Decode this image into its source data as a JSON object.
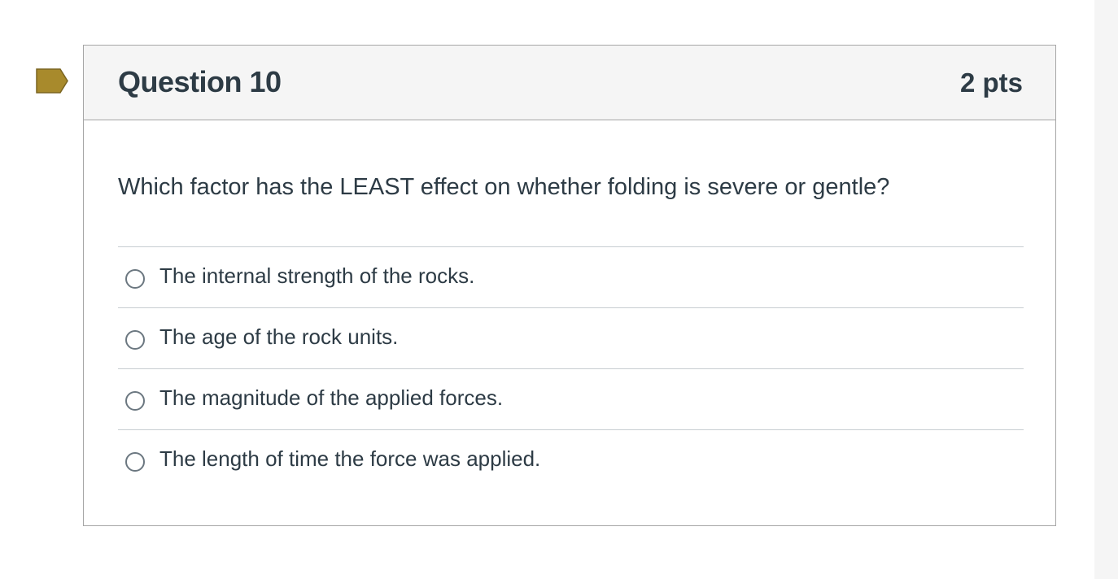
{
  "question": {
    "title": "Question 10",
    "points": "2 pts",
    "text": "Which factor has the LEAST effect on whether folding is severe or gentle?",
    "flag_color": "#a88a2c",
    "answers": [
      {
        "label": "The internal strength of the rocks.",
        "selected": false
      },
      {
        "label": "The age of the rock units.",
        "selected": false
      },
      {
        "label": "The magnitude of the applied forces.",
        "selected": false
      },
      {
        "label": "The length of time the force was applied.",
        "selected": false
      }
    ]
  }
}
